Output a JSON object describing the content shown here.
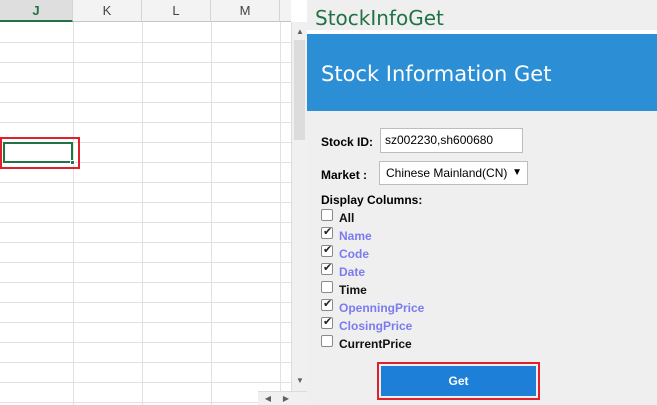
{
  "spreadsheet": {
    "columns": [
      "J",
      "K",
      "L",
      "M"
    ],
    "active_column": "J"
  },
  "pane": {
    "title": "StockInfoGet",
    "banner": "Stock Information Get",
    "stock_id_label": "Stock ID:",
    "stock_id_value": "sz002230,sh600680",
    "market_label": "Market :",
    "market_value": "Chinese Mainland(CN)",
    "display_columns_label": "Display Columns:",
    "columns": [
      {
        "label": "All",
        "checked": false
      },
      {
        "label": "Name",
        "checked": true
      },
      {
        "label": "Code",
        "checked": true
      },
      {
        "label": "Date",
        "checked": true
      },
      {
        "label": "Time",
        "checked": false
      },
      {
        "label": "OpenningPrice",
        "checked": true
      },
      {
        "label": "ClosingPrice",
        "checked": true
      },
      {
        "label": "CurrentPrice",
        "checked": false
      }
    ],
    "get_button": "Get"
  },
  "colors": {
    "banner": "#2c8fd6",
    "excel_green": "#217346",
    "button_blue": "#1e7fd8",
    "highlight_red": "#e0202a",
    "checked_label": "#7b7bf0"
  }
}
